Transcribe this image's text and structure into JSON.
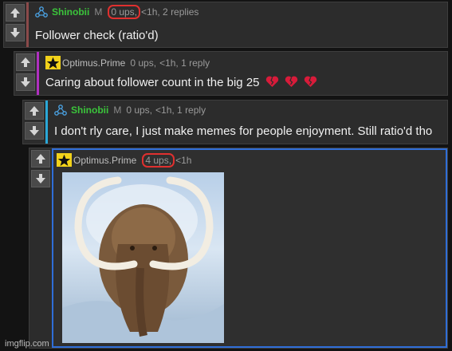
{
  "comments": [
    {
      "username": "Shinobii",
      "badge": "M",
      "ups": "0 ups,",
      "time": "<1h, 2 replies",
      "text": "Follower check (ratio'd)",
      "bar_color": "#8b4a4a"
    },
    {
      "username": "Optimus.Prime",
      "ups": "0 ups,",
      "time": "<1h, 1 reply",
      "text": "Caring about follower count in the big 25",
      "bar_color": "#b030c0"
    },
    {
      "username": "Shinobii",
      "badge": "M",
      "ups": "0 ups,",
      "time": "<1h, 1 reply",
      "text": "I don't rly care, I just make memes for people enjoyment. Still ratio'd tho",
      "bar_color": "#2aa8d8"
    },
    {
      "username": "Optimus.Prime",
      "ups": "4 ups,",
      "time": "<1h",
      "image": "woolly-mammoth-image",
      "bar_color": "#2f6ed8"
    }
  ],
  "watermark": "imgflip.com",
  "colors": {
    "highlight_circle": "#e0302f",
    "green_username": "#3bc43b",
    "heart": "#d81b3a"
  }
}
